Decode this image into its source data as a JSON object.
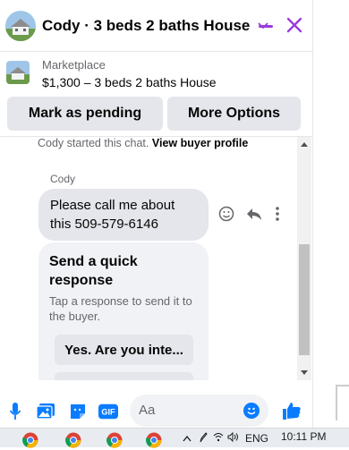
{
  "header": {
    "title": "Cody · 3 beds 2 baths House"
  },
  "listing": {
    "label": "Marketplace",
    "title": "$1,300 – 3 beds 2 baths House"
  },
  "actions": {
    "mark_pending": "Mark as pending",
    "more_options": "More Options"
  },
  "conversation": {
    "system_prefix": "Cody started this chat.",
    "system_link": "View buyer profile",
    "sender": "Cody",
    "message": "Please call me about this 509-579-6146"
  },
  "quick_response": {
    "title": "Send a quick response",
    "subtitle": "Tap a response to send it to the buyer.",
    "option_1": "Yes. Are you inte..."
  },
  "composer": {
    "placeholder": "Aa"
  },
  "taskbar": {
    "language": "ENG",
    "time": "10:11 PM"
  },
  "colors": {
    "accent": "#9b3bdf",
    "messenger_blue": "#0a7cff",
    "button_bg": "#e4e6eb"
  }
}
